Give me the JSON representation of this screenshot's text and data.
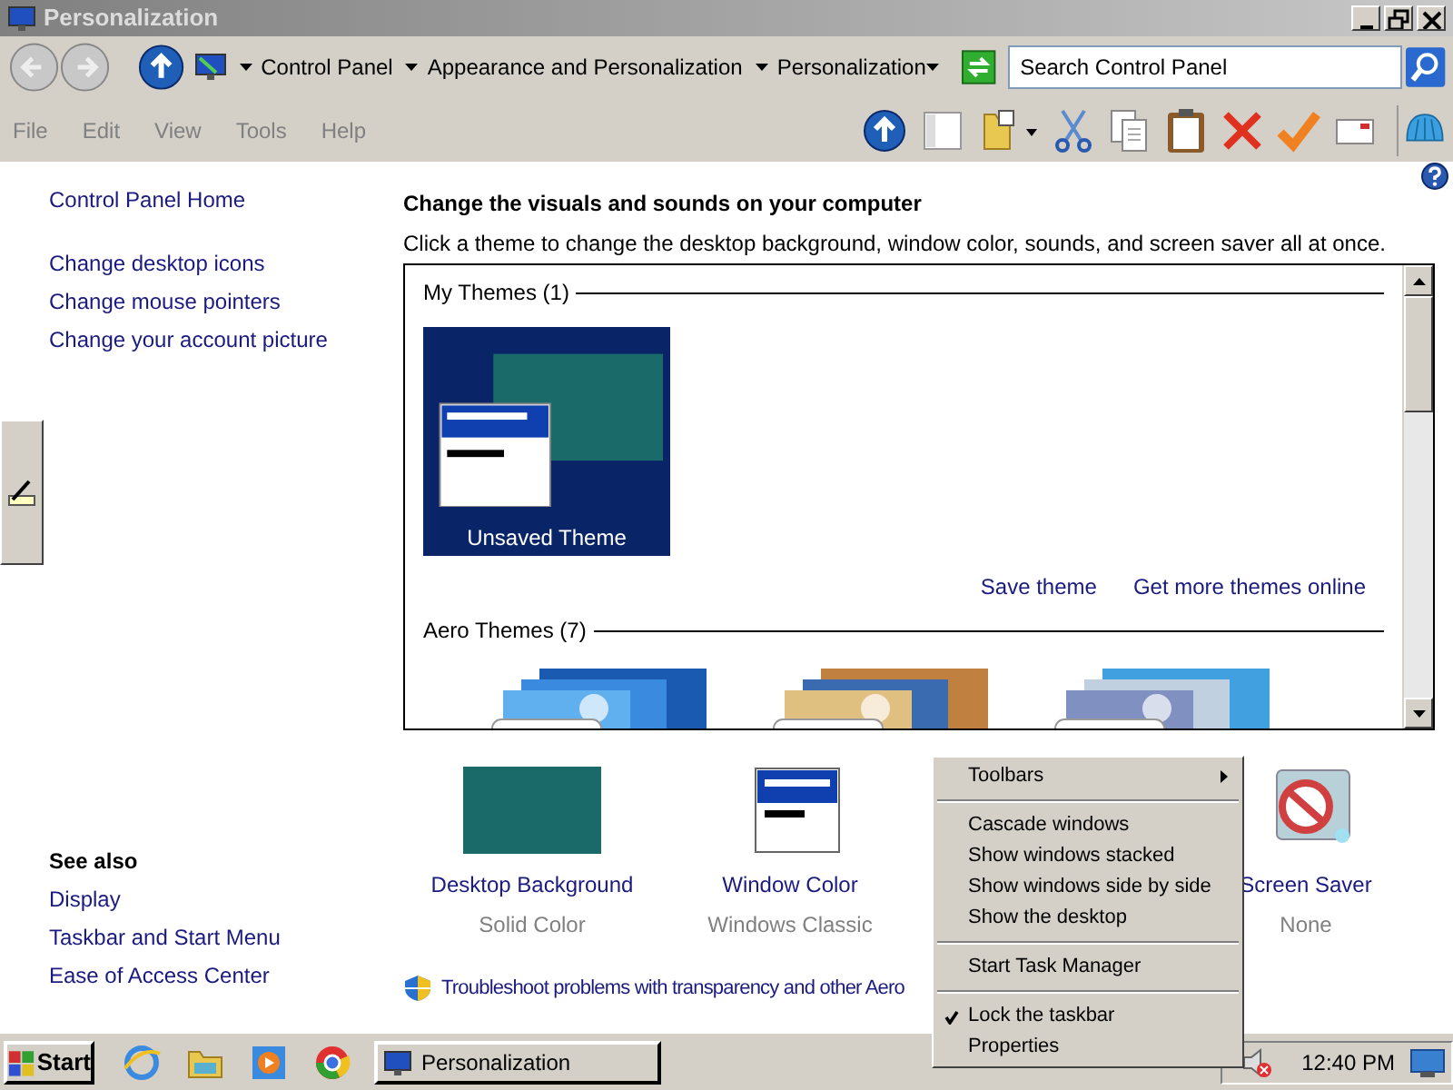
{
  "window": {
    "title": "Personalization"
  },
  "address_bar": {
    "crumbs": [
      "Control Panel",
      "Appearance and Personalization",
      "Personalization"
    ]
  },
  "search": {
    "placeholder": "Search Control Panel"
  },
  "menu": [
    "File",
    "Edit",
    "View",
    "Tools",
    "Help"
  ],
  "sidebar": {
    "links": [
      "Control Panel Home",
      "Change desktop icons",
      "Change mouse pointers",
      "Change your account picture"
    ],
    "see_also": {
      "heading": "See also",
      "links": [
        "Display",
        "Taskbar and Start Menu",
        "Ease of Access Center"
      ]
    }
  },
  "main": {
    "heading": "Change the visuals and sounds on your computer",
    "description": "Click a theme to change the desktop background, window color, sounds, and screen saver all at once.",
    "sections": [
      {
        "title": "My Themes (1)",
        "themes": [
          {
            "label": "Unsaved Theme",
            "selected": true
          }
        ],
        "links": [
          "Save theme",
          "Get more themes online"
        ]
      },
      {
        "title": "Aero Themes (7)"
      }
    ],
    "settings": [
      {
        "kind": "background",
        "label": "Desktop Background",
        "value": "Solid Color"
      },
      {
        "kind": "window",
        "label": "Window Color",
        "value": "Windows Classic"
      },
      {
        "kind": "hidden"
      },
      {
        "kind": "screensaver",
        "label": "Screen Saver",
        "value": "None"
      }
    ],
    "troubleshoot": "Troubleshoot problems with transparency and other Aero"
  },
  "context_menu": {
    "items": [
      {
        "kind": "submenu",
        "label": "Toolbars",
        "checked": false
      },
      {
        "kind": "separator"
      },
      {
        "kind": "item",
        "label": "Cascade windows",
        "checked": false
      },
      {
        "kind": "item",
        "label": "Show windows stacked",
        "checked": false
      },
      {
        "kind": "item",
        "label": "Show windows side by side",
        "checked": false
      },
      {
        "kind": "item",
        "label": "Show the desktop",
        "checked": false
      },
      {
        "kind": "separator"
      },
      {
        "kind": "item",
        "label": "Start Task Manager",
        "checked": false
      },
      {
        "kind": "separator"
      },
      {
        "kind": "item",
        "label": "Lock the taskbar",
        "checked": true
      },
      {
        "kind": "item",
        "label": "Properties",
        "checked": false
      }
    ]
  },
  "taskbar": {
    "start": "Start",
    "tasks": [
      {
        "label": "Personalization",
        "selected": false
      }
    ],
    "clock": "12:40 PM"
  }
}
